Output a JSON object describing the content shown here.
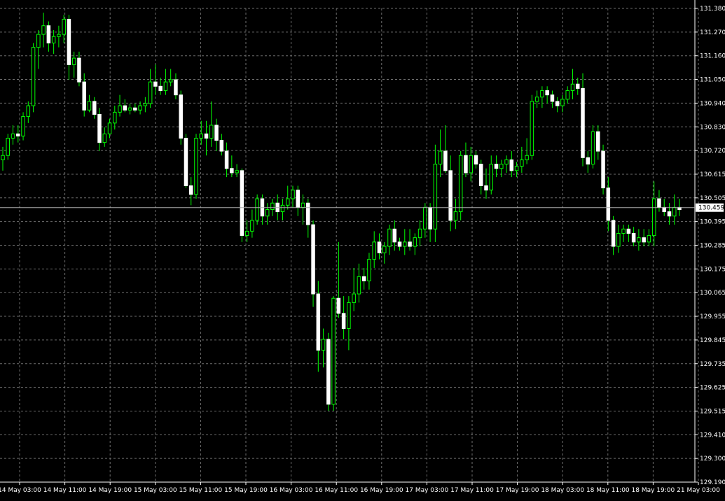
{
  "colors": {
    "background": "#000000",
    "grid": "#6e6e6e",
    "axis": "#ffffff",
    "text": "#ffffff",
    "bull_body": "#000000",
    "bull_outline": "#00ff00",
    "bear_body": "#ffffff",
    "bear_outline": "#ffffff",
    "wick": "#00ff00",
    "price_line": "#aaaaaa",
    "price_label_bg": "#ffffff",
    "price_label_text": "#000000"
  },
  "chart_data": {
    "type": "candlestick",
    "price_ticks": [
      "131.380",
      "131.270",
      "131.160",
      "131.050",
      "130.940",
      "130.830",
      "130.720",
      "130.615",
      "130.505",
      "130.395",
      "130.285",
      "130.175",
      "130.065",
      "129.955",
      "129.845",
      "129.735",
      "129.625",
      "129.515",
      "129.410",
      "129.300",
      "129.190"
    ],
    "time_ticks": [
      "14 May 03:00",
      "14 May 11:00",
      "14 May 19:00",
      "15 May 03:00",
      "15 May 11:00",
      "15 May 19:00",
      "16 May 03:00",
      "16 May 11:00",
      "16 May 19:00",
      "17 May 03:00",
      "17 May 11:00",
      "17 May 19:00",
      "18 May 03:00",
      "18 May 11:00",
      "18 May 19:00",
      "21 May 03:00"
    ],
    "ylim": [
      129.19,
      131.38
    ],
    "current_price": "130.459",
    "candles": [
      [
        130.68,
        130.74,
        130.63,
        130.7
      ],
      [
        130.7,
        130.8,
        130.68,
        130.78
      ],
      [
        130.78,
        130.84,
        130.75,
        130.8
      ],
      [
        130.8,
        130.84,
        130.76,
        130.79
      ],
      [
        130.79,
        130.9,
        130.77,
        130.88
      ],
      [
        130.88,
        130.95,
        130.85,
        130.93
      ],
      [
        130.93,
        131.22,
        130.9,
        131.2
      ],
      [
        131.2,
        131.28,
        131.1,
        131.26
      ],
      [
        131.26,
        131.36,
        131.2,
        131.3
      ],
      [
        131.3,
        131.32,
        131.18,
        131.22
      ],
      [
        131.22,
        131.28,
        131.17,
        131.25
      ],
      [
        131.25,
        131.3,
        131.2,
        131.26
      ],
      [
        131.26,
        131.35,
        131.22,
        131.33
      ],
      [
        131.33,
        131.35,
        131.05,
        131.12
      ],
      [
        131.12,
        131.18,
        131.06,
        131.15
      ],
      [
        131.15,
        131.18,
        131.02,
        131.04
      ],
      [
        131.04,
        131.08,
        130.88,
        130.91
      ],
      [
        130.91,
        130.98,
        130.9,
        130.95
      ],
      [
        130.95,
        130.97,
        130.87,
        130.89
      ],
      [
        130.89,
        130.92,
        130.72,
        130.76
      ],
      [
        130.76,
        130.83,
        130.74,
        130.8
      ],
      [
        130.8,
        130.87,
        130.78,
        130.85
      ],
      [
        130.85,
        130.93,
        130.82,
        130.9
      ],
      [
        130.9,
        130.98,
        130.88,
        130.93
      ],
      [
        130.93,
        130.96,
        130.9,
        130.91
      ],
      [
        130.91,
        130.94,
        130.89,
        130.92
      ],
      [
        130.92,
        130.94,
        130.9,
        130.91
      ],
      [
        130.91,
        130.95,
        130.89,
        130.93
      ],
      [
        130.93,
        130.97,
        130.9,
        130.94
      ],
      [
        130.94,
        131.1,
        130.92,
        131.04
      ],
      [
        131.04,
        131.12,
        130.98,
        131.02
      ],
      [
        131.02,
        131.06,
        130.98,
        131.0
      ],
      [
        131.0,
        131.1,
        130.98,
        131.04
      ],
      [
        131.04,
        131.1,
        131.02,
        131.05
      ],
      [
        131.05,
        131.08,
        130.96,
        130.98
      ],
      [
        130.98,
        131.0,
        130.75,
        130.78
      ],
      [
        130.78,
        130.8,
        130.55,
        130.56
      ],
      [
        130.56,
        130.6,
        130.47,
        130.52
      ],
      [
        130.52,
        130.8,
        130.5,
        130.78
      ],
      [
        130.78,
        130.86,
        130.75,
        130.8
      ],
      [
        130.8,
        130.86,
        130.7,
        130.78
      ],
      [
        130.78,
        130.95,
        130.74,
        130.84
      ],
      [
        130.84,
        130.87,
        130.72,
        130.77
      ],
      [
        130.77,
        130.8,
        130.7,
        130.72
      ],
      [
        130.72,
        130.76,
        130.6,
        130.64
      ],
      [
        130.64,
        130.7,
        130.6,
        130.62
      ],
      [
        130.62,
        130.66,
        130.6,
        130.63
      ],
      [
        130.63,
        130.64,
        130.3,
        130.33
      ],
      [
        130.33,
        130.4,
        130.3,
        130.35
      ],
      [
        130.35,
        130.45,
        130.32,
        130.4
      ],
      [
        130.4,
        130.52,
        130.38,
        130.5
      ],
      [
        130.5,
        130.52,
        130.38,
        130.42
      ],
      [
        130.42,
        130.48,
        130.38,
        130.45
      ],
      [
        130.45,
        130.5,
        130.42,
        130.48
      ],
      [
        130.48,
        130.52,
        130.4,
        130.44
      ],
      [
        130.44,
        130.5,
        130.4,
        130.47
      ],
      [
        130.47,
        130.56,
        130.45,
        130.5
      ],
      [
        130.5,
        130.56,
        130.46,
        130.54
      ],
      [
        130.54,
        130.56,
        130.42,
        130.46
      ],
      [
        130.46,
        130.52,
        130.38,
        130.48
      ],
      [
        130.48,
        130.5,
        130.32,
        130.38
      ],
      [
        130.38,
        130.4,
        130.0,
        130.06
      ],
      [
        130.06,
        130.12,
        129.7,
        129.8
      ],
      [
        129.8,
        129.9,
        129.72,
        129.85
      ],
      [
        129.85,
        129.88,
        129.52,
        129.55
      ],
      [
        129.55,
        130.05,
        129.52,
        130.04
      ],
      [
        130.04,
        130.3,
        129.95,
        129.97
      ],
      [
        129.97,
        130.05,
        129.85,
        129.9
      ],
      [
        129.9,
        130.05,
        129.8,
        130.02
      ],
      [
        130.02,
        130.18,
        129.98,
        130.06
      ],
      [
        130.06,
        130.2,
        130.02,
        130.14
      ],
      [
        130.14,
        130.18,
        130.08,
        130.12
      ],
      [
        130.12,
        130.25,
        130.08,
        130.22
      ],
      [
        130.22,
        130.35,
        130.18,
        130.3
      ],
      [
        130.3,
        130.34,
        130.22,
        130.25
      ],
      [
        130.25,
        130.3,
        130.2,
        130.28
      ],
      [
        130.28,
        130.38,
        130.24,
        130.36
      ],
      [
        130.36,
        130.4,
        130.26,
        130.3
      ],
      [
        130.3,
        130.32,
        130.26,
        130.28
      ],
      [
        130.28,
        130.36,
        130.24,
        130.3
      ],
      [
        130.3,
        130.36,
        130.26,
        130.28
      ],
      [
        130.28,
        130.34,
        130.24,
        130.32
      ],
      [
        130.32,
        130.4,
        130.28,
        130.36
      ],
      [
        130.36,
        130.48,
        130.32,
        130.46
      ],
      [
        130.46,
        130.48,
        130.3,
        130.36
      ],
      [
        130.36,
        130.75,
        130.3,
        130.66
      ],
      [
        130.66,
        130.82,
        130.6,
        130.72
      ],
      [
        130.72,
        130.84,
        130.62,
        130.63
      ],
      [
        130.63,
        130.7,
        130.35,
        130.4
      ],
      [
        130.4,
        130.5,
        130.36,
        130.44
      ],
      [
        130.44,
        130.72,
        130.4,
        130.7
      ],
      [
        130.7,
        130.76,
        130.6,
        130.62
      ],
      [
        130.62,
        130.74,
        130.58,
        130.7
      ],
      [
        130.7,
        130.72,
        130.64,
        130.66
      ],
      [
        130.66,
        130.68,
        130.52,
        130.56
      ],
      [
        130.56,
        130.64,
        130.5,
        130.54
      ],
      [
        130.54,
        130.7,
        130.52,
        130.66
      ],
      [
        130.66,
        130.7,
        130.6,
        130.64
      ],
      [
        130.64,
        130.68,
        130.6,
        130.66
      ],
      [
        130.66,
        130.7,
        130.62,
        130.68
      ],
      [
        130.68,
        130.72,
        130.6,
        130.63
      ],
      [
        130.63,
        130.67,
        130.6,
        130.65
      ],
      [
        130.65,
        130.74,
        130.62,
        130.68
      ],
      [
        130.68,
        130.78,
        130.66,
        130.7
      ],
      [
        130.7,
        130.98,
        130.68,
        130.95
      ],
      [
        130.95,
        131.0,
        130.92,
        130.97
      ],
      [
        130.97,
        131.02,
        130.92,
        131.0
      ],
      [
        131.0,
        131.02,
        130.94,
        130.98
      ],
      [
        130.98,
        131.0,
        130.92,
        130.95
      ],
      [
        130.95,
        130.97,
        130.9,
        130.93
      ],
      [
        130.93,
        130.98,
        130.9,
        130.96
      ],
      [
        130.96,
        131.02,
        130.94,
        131.0
      ],
      [
        131.0,
        131.1,
        130.96,
        131.03
      ],
      [
        131.03,
        131.06,
        130.98,
        131.01
      ],
      [
        131.01,
        131.08,
        130.65,
        130.69
      ],
      [
        130.69,
        130.72,
        130.62,
        130.66
      ],
      [
        130.66,
        130.84,
        130.64,
        130.81
      ],
      [
        130.81,
        130.84,
        130.68,
        130.72
      ],
      [
        130.72,
        130.75,
        130.52,
        130.55
      ],
      [
        130.55,
        130.6,
        130.35,
        130.4
      ],
      [
        130.4,
        130.42,
        130.24,
        130.28
      ],
      [
        130.28,
        130.38,
        130.25,
        130.34
      ],
      [
        130.34,
        130.38,
        130.3,
        130.36
      ],
      [
        130.36,
        130.38,
        130.3,
        130.34
      ],
      [
        130.34,
        130.37,
        130.28,
        130.3
      ],
      [
        130.3,
        130.36,
        130.26,
        130.32
      ],
      [
        130.32,
        130.36,
        130.28,
        130.3
      ],
      [
        130.3,
        130.36,
        130.28,
        130.33
      ],
      [
        130.33,
        130.58,
        130.28,
        130.5
      ],
      [
        130.5,
        130.54,
        130.44,
        130.46
      ],
      [
        130.46,
        130.5,
        130.42,
        130.44
      ],
      [
        130.44,
        130.48,
        130.38,
        130.42
      ],
      [
        130.42,
        130.52,
        130.38,
        130.46
      ],
      [
        130.46,
        130.5,
        130.42,
        130.45
      ]
    ]
  }
}
